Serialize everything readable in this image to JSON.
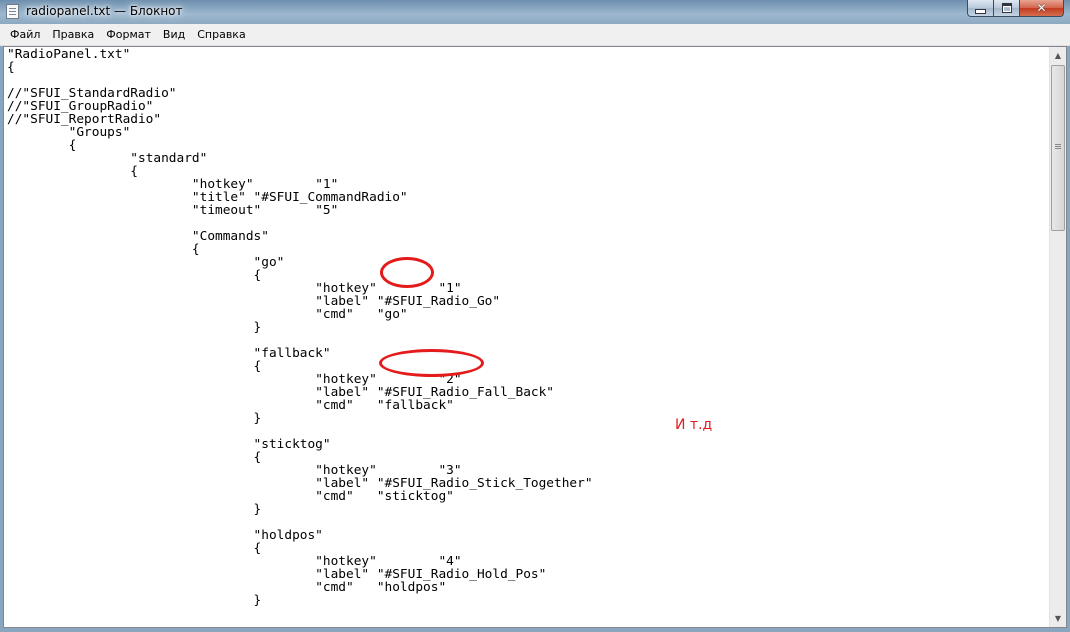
{
  "window": {
    "title": "radiopanel.txt — Блокнот"
  },
  "menu": [
    {
      "label": "Файл"
    },
    {
      "label": "Правка"
    },
    {
      "label": "Формат"
    },
    {
      "label": "Вид"
    },
    {
      "label": "Справка"
    }
  ],
  "editor": {
    "lines": [
      "\"RadioPanel.txt\"",
      "{",
      "",
      "//\"SFUI_StandardRadio\"",
      "//\"SFUI_GroupRadio\"",
      "//\"SFUI_ReportRadio\"",
      "\t\"Groups\"",
      "\t{",
      "\t\t\"standard\"",
      "\t\t{",
      "\t\t\t\"hotkey\"\t\"1\"",
      "\t\t\t\"title\"\t\"#SFUI_CommandRadio\"",
      "\t\t\t\"timeout\"\t\"5\"",
      "",
      "\t\t\t\"Commands\"",
      "\t\t\t{",
      "\t\t\t\t\"go\"",
      "\t\t\t\t{",
      "\t\t\t\t\t\"hotkey\"\t\"1\"",
      "\t\t\t\t\t\"label\"\t\"#SFUI_Radio_Go\"",
      "\t\t\t\t\t\"cmd\"\t\"go\"",
      "\t\t\t\t}",
      "",
      "\t\t\t\t\"fallback\"",
      "\t\t\t\t{",
      "\t\t\t\t\t\"hotkey\"\t\"2\"",
      "\t\t\t\t\t\"label\"\t\"#SFUI_Radio_Fall_Back\"",
      "\t\t\t\t\t\"cmd\"\t\"fallback\"",
      "\t\t\t\t}",
      "",
      "\t\t\t\t\"sticktog\"",
      "\t\t\t\t{",
      "\t\t\t\t\t\"hotkey\"\t\"3\"",
      "\t\t\t\t\t\"label\"\t\"#SFUI_Radio_Stick_Together\"",
      "\t\t\t\t\t\"cmd\"\t\"sticktog\"",
      "\t\t\t\t}",
      "",
      "\t\t\t\t\"holdpos\"",
      "\t\t\t\t{",
      "\t\t\t\t\t\"hotkey\"\t\"4\"",
      "\t\t\t\t\t\"label\"\t\"#SFUI_Radio_Hold_Pos\"",
      "\t\t\t\t\t\"cmd\"\t\"holdpos\"",
      "\t\t\t\t}"
    ]
  },
  "annotations": {
    "note": "И т.д",
    "highlight_color": "#e41b1b"
  }
}
